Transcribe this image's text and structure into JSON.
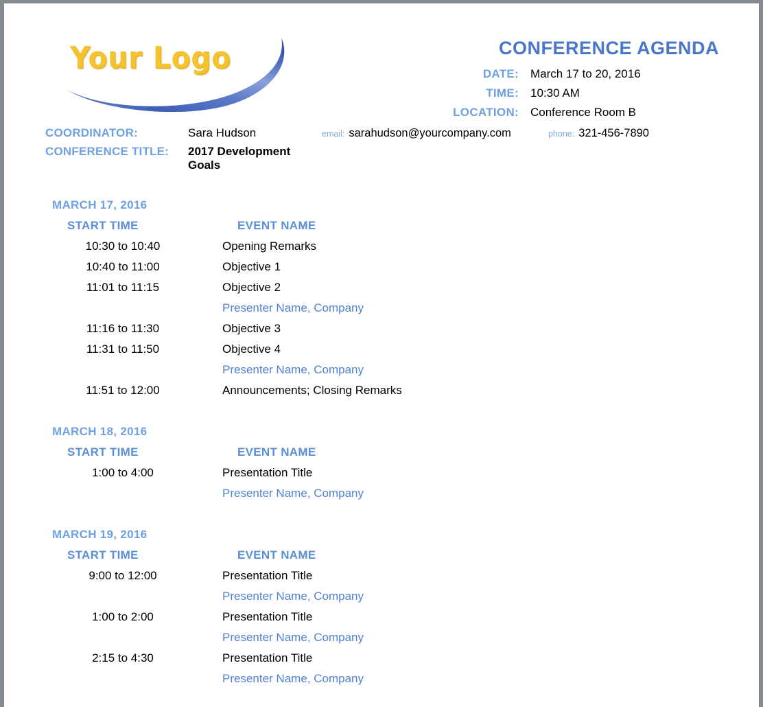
{
  "logo": {
    "text": "Your Logo",
    "text_color": "#f5c230",
    "swoosh_color_light": "#8aa6dd",
    "swoosh_color_dark": "#2e4a9e"
  },
  "header": {
    "title": "CONFERENCE AGENDA",
    "title_color": "#4a77c8",
    "meta": [
      {
        "label": "DATE:",
        "value": "March 17 to 20, 2016"
      },
      {
        "label": "TIME:",
        "value": "10:30 AM"
      },
      {
        "label": "LOCATION:",
        "value": "Conference Room B"
      }
    ]
  },
  "coordinator": {
    "coordinator_label": "COORDINATOR:",
    "coordinator_name": "Sara Hudson",
    "email_label": "email:",
    "email_value": "sarahudson@yourcompany.com",
    "phone_label": "phone:",
    "phone_value": "321-456-7890",
    "title_label": "CONFERENCE TITLE:",
    "title_value": "2017 Development Goals"
  },
  "agenda": {
    "label_color": "#6fa0e2",
    "presenter_color": "#5181d2",
    "column_headers": {
      "time": "START TIME",
      "event": "EVENT NAME"
    },
    "days": [
      {
        "date": "MARCH 17, 2016",
        "rows": [
          {
            "time": "10:30 to 10:40",
            "event": "Opening Remarks",
            "kind": "event"
          },
          {
            "time": "10:40 to 11:00",
            "event": "Objective 1",
            "kind": "event"
          },
          {
            "time": "11:01 to 11:15",
            "event": "Objective 2",
            "kind": "event"
          },
          {
            "time": "",
            "event": "Presenter Name, Company",
            "kind": "presenter"
          },
          {
            "time": "11:16 to 11:30",
            "event": "Objective 3",
            "kind": "event"
          },
          {
            "time": "11:31 to 11:50",
            "event": "Objective 4",
            "kind": "event"
          },
          {
            "time": "",
            "event": "Presenter Name, Company",
            "kind": "presenter"
          },
          {
            "time": "11:51 to 12:00",
            "event": "Announcements; Closing Remarks",
            "kind": "event"
          }
        ]
      },
      {
        "date": "MARCH 18, 2016",
        "rows": [
          {
            "time": "1:00 to 4:00",
            "event": "Presentation Title",
            "kind": "event"
          },
          {
            "time": "",
            "event": "Presenter Name, Company",
            "kind": "presenter"
          }
        ]
      },
      {
        "date": "MARCH 19, 2016",
        "rows": [
          {
            "time": "9:00 to 12:00",
            "event": "Presentation Title",
            "kind": "event"
          },
          {
            "time": "",
            "event": "Presenter Name, Company",
            "kind": "presenter"
          },
          {
            "time": "1:00 to 2:00",
            "event": "Presentation Title",
            "kind": "event"
          },
          {
            "time": "",
            "event": "Presenter Name, Company",
            "kind": "presenter"
          },
          {
            "time": "2:15 to 4:30",
            "event": "Presentation Title",
            "kind": "event"
          },
          {
            "time": "",
            "event": "Presenter Name, Company",
            "kind": "presenter"
          }
        ]
      }
    ]
  }
}
